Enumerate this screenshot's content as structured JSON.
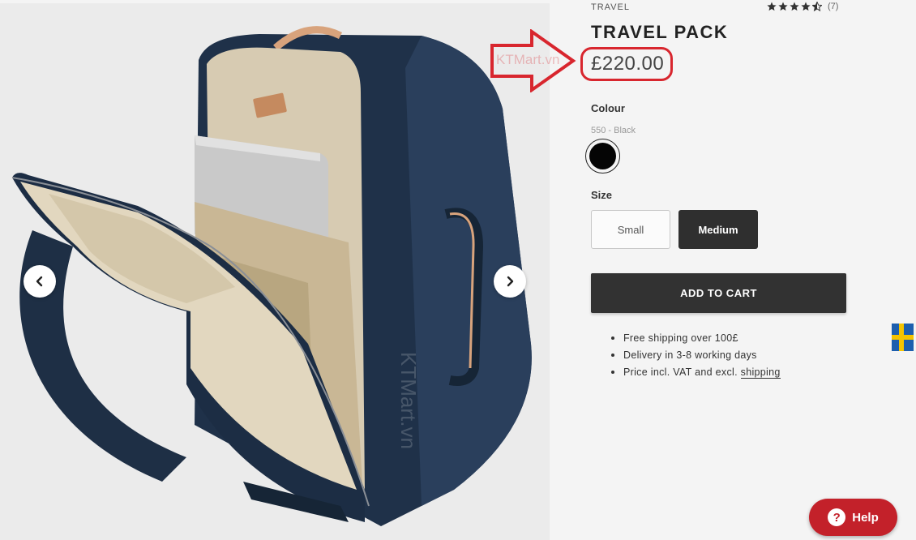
{
  "product": {
    "category": "TRAVEL",
    "title": "TRAVEL PACK",
    "price": "£220.00",
    "rating_count": "(7)",
    "rating_value": 4.5
  },
  "watermark": {
    "text": "KTMart.vn",
    "color": "#d8262e"
  },
  "colour": {
    "label": "Colour",
    "selected_name": "550 - Black",
    "swatch_color": "#050505"
  },
  "size": {
    "label": "Size",
    "options": [
      "Small",
      "Medium"
    ],
    "selected": "Medium"
  },
  "cart": {
    "label": "ADD TO CART"
  },
  "benefits": {
    "items": [
      "Free shipping over 100£",
      "Delivery in 3-8 working days",
      "Price incl. VAT and excl. "
    ],
    "shipping_link": "shipping"
  },
  "help": {
    "label": "Help",
    "icon_glyph": "?"
  },
  "colors": {
    "accent_red": "#c3212a",
    "button_dark": "#323232",
    "flag_blue": "#1d5fae",
    "flag_yellow": "#f5c400"
  },
  "icons": {
    "prev": "chevron-left-icon",
    "next": "chevron-right-icon",
    "star": "star-icon",
    "flag": "sweden-flag-icon",
    "help": "question-icon"
  }
}
